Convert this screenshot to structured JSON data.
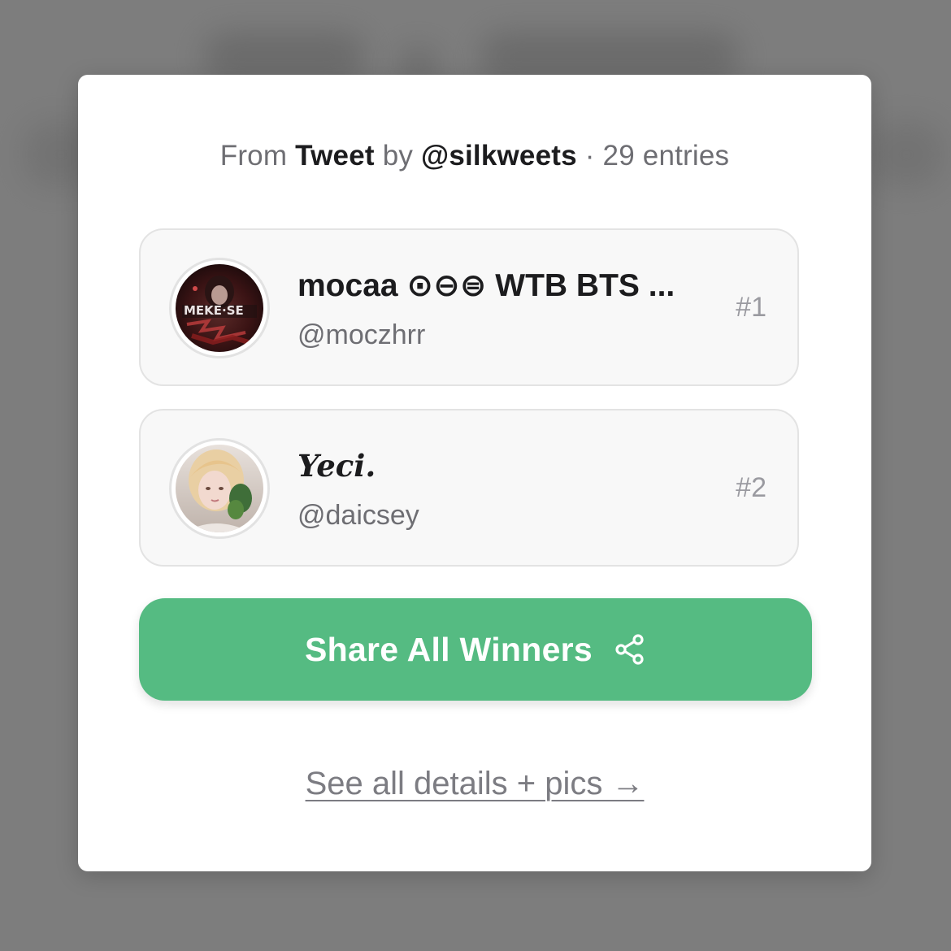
{
  "source": {
    "prefix": "From",
    "source_type": "Tweet",
    "by": "by",
    "author": "@silkweets",
    "separator": "·",
    "entries": "29 entries"
  },
  "winners": [
    {
      "display_name": "mocaa ⊙⊖⊜ WTB BTS ...",
      "handle": "@moczhrr",
      "rank": "#1"
    },
    {
      "display_name": "Yeci.",
      "handle": "@daicsey",
      "rank": "#2"
    }
  ],
  "share_button": {
    "label": "Share All Winners",
    "icon": "share-icon",
    "color": "#55bb82"
  },
  "details_link": {
    "label": "See all details + pics →"
  }
}
